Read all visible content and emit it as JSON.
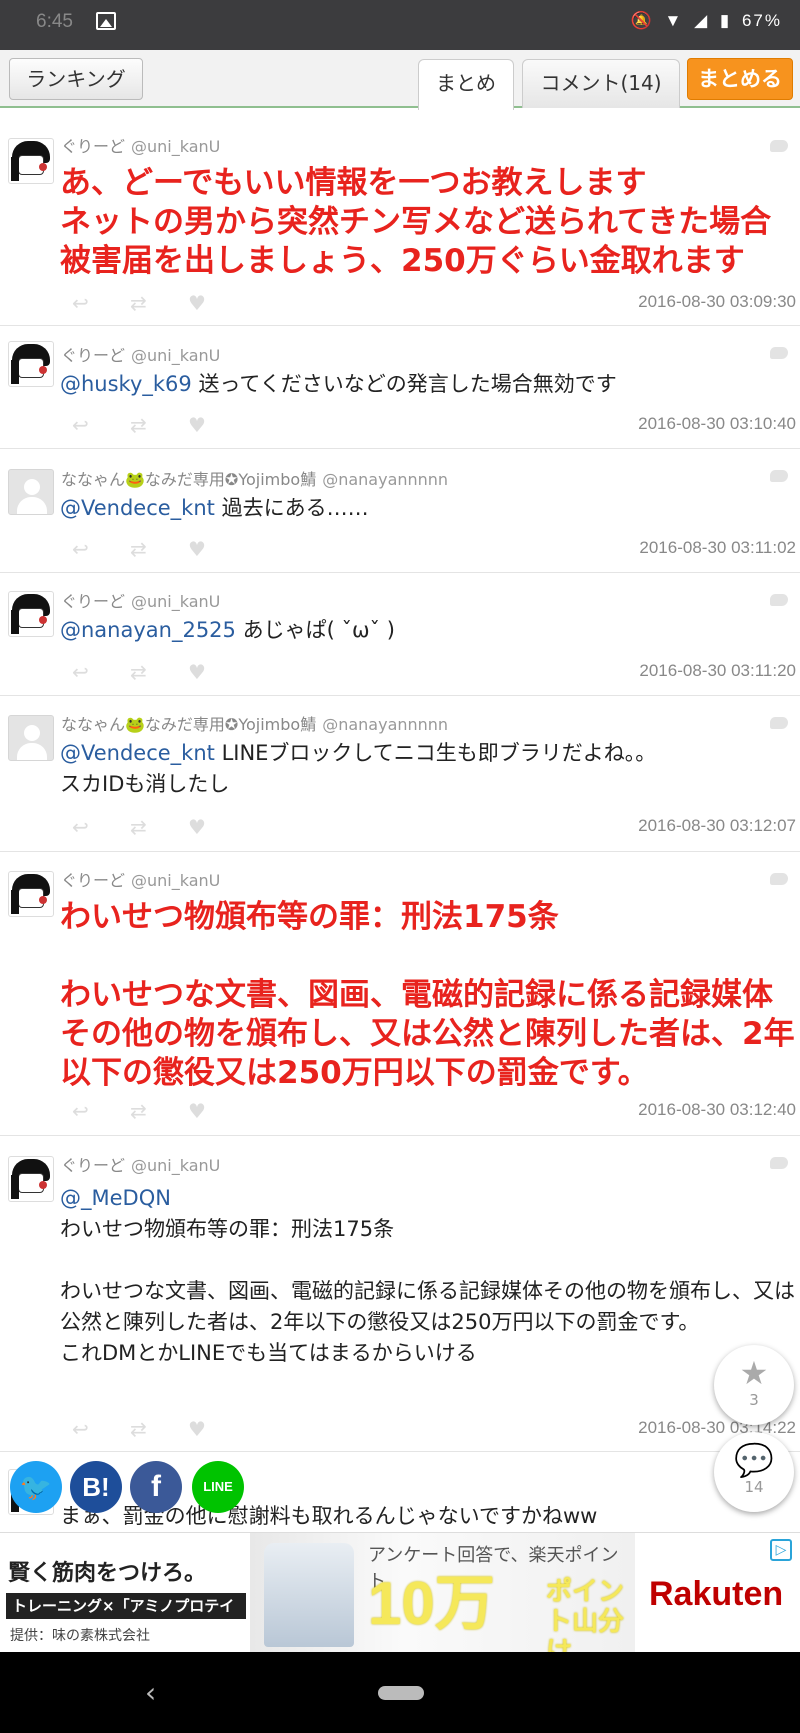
{
  "status_bar": {
    "time": "6:45",
    "battery": "67%"
  },
  "header": {
    "ranking_label": "ランキング",
    "tab_matome": "まとめ",
    "tab_comment": "コメント(14)",
    "matomeru_label": "まとめる"
  },
  "tweets": [
    {
      "display_name": "ぐりーど",
      "screen_name": "@uni_kanU",
      "mention": "",
      "text": "あ、どーでもいい情報を一つお教えします\nネットの男から突然チン写メなど送られてきた場合被害届を出しましょう、250万ぐらい金取れます",
      "time": "2016-08-30 03:09:30"
    },
    {
      "display_name": "ぐりーど",
      "screen_name": "@uni_kanU",
      "mention": "@husky_k69",
      "text": " 送ってくださいなどの発言した場合無効です",
      "time": "2016-08-30 03:10:40"
    },
    {
      "display_name": "ななゃん🐸なみだ専用✪Yojimbo鯖",
      "screen_name": "@nanayannnnn",
      "mention": "@Vendece_knt",
      "text": " 過去にある……",
      "time": "2016-08-30 03:11:02"
    },
    {
      "display_name": "ぐりーど",
      "screen_name": "@uni_kanU",
      "mention": "@nanayan_2525",
      "text": " あじゃぱ( ˇωˇ )",
      "time": "2016-08-30 03:11:20"
    },
    {
      "display_name": "ななゃん🐸なみだ専用✪Yojimbo鯖",
      "screen_name": "@nanayannnnn",
      "mention": "@Vendece_knt",
      "text": " LINEブロックしてニコ生も即ブラリだよね。。\nスカIDも消したし",
      "time": "2016-08-30 03:12:07"
    },
    {
      "display_name": "ぐりーど",
      "screen_name": "@uni_kanU",
      "mention": "",
      "text": "わいせつ物頒布等の罪：刑法175条\n\nわいせつな文書、図画、電磁的記録に係る記録媒体その他の物を頒布し、又は公然と陳列した者は、2年以下の懲役又は250万円以下の罰金です。",
      "time": "2016-08-30 03:12:40"
    },
    {
      "display_name": "ぐりーど",
      "screen_name": "@uni_kanU",
      "mention": "@_MeDQN",
      "text": "\nわいせつ物頒布等の罪：刑法175条\n\nわいせつな文書、図画、電磁的記録に係る記録媒体その他の物を頒布し、又は公然と陳列した者は、2年以下の懲役又は250万円以下の罰金です。\nこれDMとかLINEでも当てはまるからいける",
      "time": "2016-08-30 03:14:22"
    },
    {
      "display_name": "",
      "screen_name": "",
      "mention": "",
      "text": "まぁ、罰金の他に慰謝料も取れるんじゃないですかねww",
      "time": ""
    }
  ],
  "floating": {
    "favorite_count": "3",
    "comment_count": "14"
  },
  "share": {
    "hatena": "B!",
    "facebook": "f",
    "line": "LINE"
  },
  "ad": {
    "headline": "賢く筋肉をつけろ。",
    "tagline": "トレーニング×「アミノプロテイン」",
    "sponsor": "提供：味の素株式会社",
    "survey": "アンケート回答で、楽天ポイント",
    "big": "10万",
    "points": "ポイント山分け",
    "brand": "Rakuten"
  },
  "colors": {
    "accent_orange": "#f7931e",
    "highlight_red": "#e8231e",
    "mention_blue": "#2a5d9f"
  }
}
